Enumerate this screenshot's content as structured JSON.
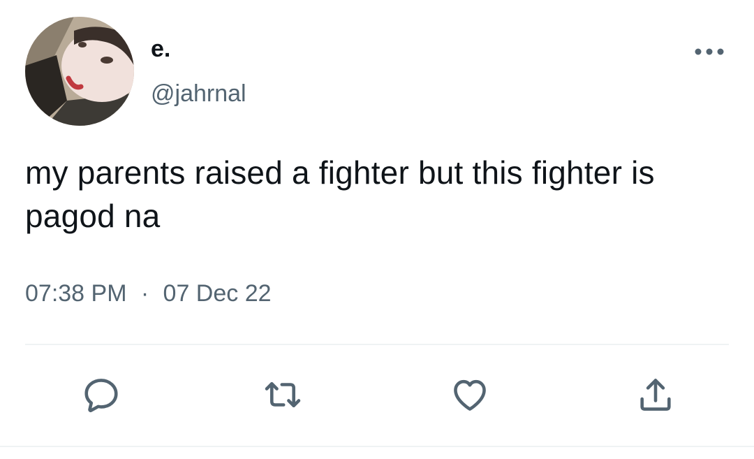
{
  "author": {
    "display_name": "e.",
    "handle": "@jahrnal"
  },
  "tweet": {
    "text": "my parents raised a fighter but this fighter is pagod na",
    "time": "07:38 PM",
    "separator": "·",
    "date": "07 Dec 22"
  },
  "icons": {
    "more": "more-horizontal-icon",
    "reply": "reply-icon",
    "retweet": "retweet-icon",
    "like": "heart-icon",
    "share": "share-icon"
  },
  "colors": {
    "text_primary": "#0f1419",
    "text_secondary": "#536471",
    "icon": "#536471",
    "divider": "#eff3f4"
  }
}
